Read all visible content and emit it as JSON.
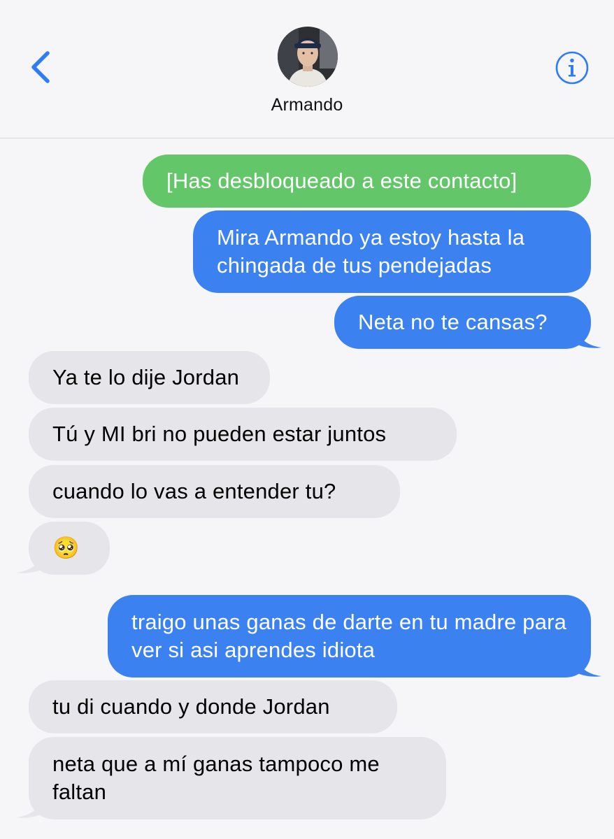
{
  "header": {
    "contact_name": "Armando",
    "back_icon": "chevron-left-icon",
    "info_icon": "info-circle-icon"
  },
  "colors": {
    "outgoing": "#3b82f0",
    "system_green": "#63c668",
    "incoming": "#e6e5ea",
    "accent": "#2f7cf6"
  },
  "messages": [
    {
      "side": "out-green",
      "text": "[Has desbloqueado a este contacto]"
    },
    {
      "side": "out",
      "text": "Mira Armando ya estoy hasta la chingada de tus pendejadas"
    },
    {
      "side": "out",
      "text": "Neta no te cansas?"
    },
    {
      "side": "in",
      "text": "Ya te lo dije Jordan"
    },
    {
      "side": "in",
      "text": "Tú y MI bri no pueden estar juntos"
    },
    {
      "side": "in",
      "text": "cuando lo vas a entender tu?"
    },
    {
      "side": "in",
      "text": "🥺"
    },
    {
      "side": "out",
      "text": "traigo unas ganas de darte en tu madre para ver si asi aprendes idiota"
    },
    {
      "side": "in",
      "text": "tu di cuando y donde Jordan"
    },
    {
      "side": "in",
      "text": "neta que a mí ganas tampoco me faltan"
    }
  ]
}
